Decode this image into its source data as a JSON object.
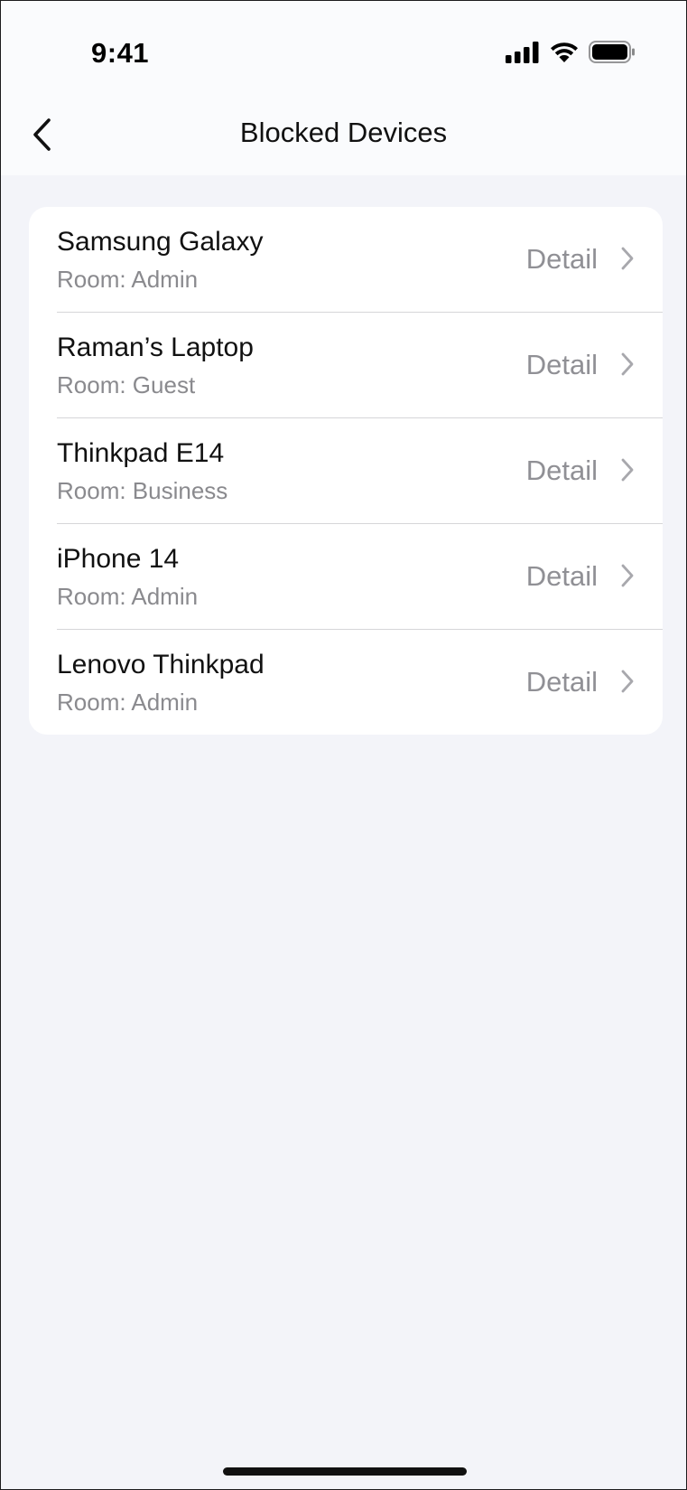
{
  "status_bar": {
    "time": "9:41"
  },
  "header": {
    "title": "Blocked Devices"
  },
  "devices": [
    {
      "name": "Samsung Galaxy",
      "room": "Room: Admin",
      "action": "Detail"
    },
    {
      "name": "Raman’s Laptop",
      "room": "Room: Guest",
      "action": "Detail"
    },
    {
      "name": "Thinkpad E14",
      "room": "Room: Business",
      "action": "Detail"
    },
    {
      "name": "iPhone 14",
      "room": "Room: Admin",
      "action": "Detail"
    },
    {
      "name": "Lenovo Thinkpad",
      "room": "Room: Admin",
      "action": "Detail"
    }
  ],
  "colors": {
    "background": "#f3f4f9",
    "header_background": "#fafbfd",
    "card_background": "#ffffff",
    "secondary_text": "#8a8a8e"
  },
  "icons": {
    "back": "chevron-left-icon",
    "row_arrow": "chevron-right-icon",
    "signal": "cellular-signal-icon",
    "wifi": "wifi-icon",
    "battery": "battery-icon"
  }
}
